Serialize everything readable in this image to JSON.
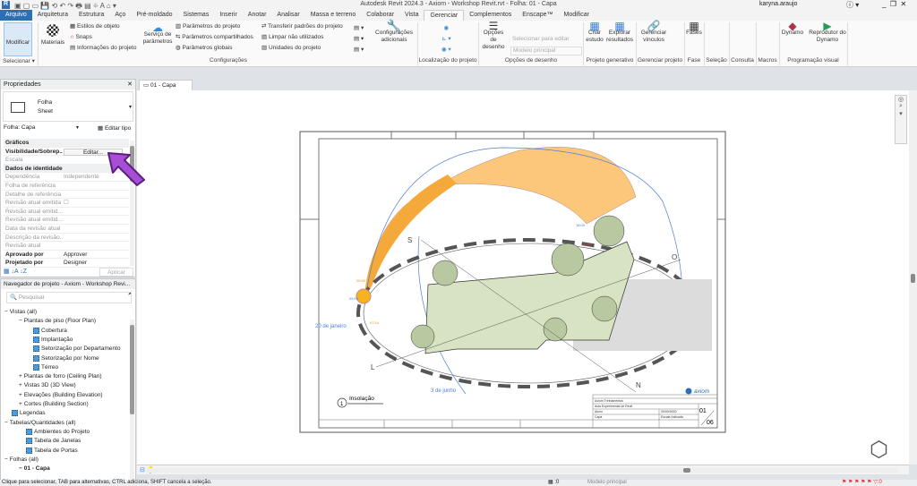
{
  "app": {
    "title": "Autodesk Revit 2024.3 - Axiom - Workshop Revit.rvt - Folha: 01 - Capa",
    "user": "karyna.araujo",
    "logo": "R"
  },
  "tabs": [
    "Arquivo",
    "Arquitetura",
    "Estrutura",
    "Aço",
    "Pré-moldado",
    "Sistemas",
    "Inserir",
    "Anotar",
    "Analisar",
    "Massa e terreno",
    "Colaborar",
    "Vista",
    "Gerenciar",
    "Complementos",
    "Enscape™",
    "Modificar"
  ],
  "active_tab": "Gerenciar",
  "ribbon": {
    "modificar": "Modificar",
    "materiais": "Materiais",
    "estilos": "Estilos de objeto",
    "snaps": "Snaps",
    "info": "Informações do projeto",
    "servico": "Serviço de parâmetros",
    "par_proj": "Parâmetros do projeto",
    "par_comp": "Parâmetros compartilhados",
    "par_glob": "Parâmetros globais",
    "transferir": "Transferir padrões do projeto",
    "limpar": "Limpar não utilizados",
    "unidades": "Unidades do projeto",
    "config_ad": "Configurações adicionais",
    "opcoes_des": "Opções de desenho",
    "sel_editar": "Selecionar para editar",
    "modelo_principal": "Modelo principal",
    "criar": "Criar estudo",
    "explorar": "Explorar resultados",
    "gerenciar_vinc": "Gerenciar vínculos",
    "fases": "Fases",
    "dynamo": "Dynamo",
    "reprodutor": "Reprodutor do Dynamo",
    "panels": [
      "Selecionar ▾",
      "Configurações",
      "Localização do projeto",
      "Opções de desenho",
      "Projeto generativo",
      "Gerenciar projeto",
      "Fase",
      "Seleção",
      "Consulta",
      "Macros",
      "Programação visual"
    ]
  },
  "properties": {
    "header": "Propriedades",
    "type_line1": "Folha",
    "type_line2": "Sheet",
    "instance": "Folha: Capa",
    "edit_type": "Editar tipo",
    "apply": "Aplicar",
    "rows": [
      {
        "k": "Gráficos",
        "v": "",
        "section": true
      },
      {
        "k": "Visibilidade/Sobrep...",
        "v": "Editar...",
        "bold": true
      },
      {
        "k": "Escala",
        "v": "",
        "grey": true
      },
      {
        "k": "Dados de identidade",
        "v": "",
        "section": true
      },
      {
        "k": "Dependência",
        "v": "Independente",
        "grey": true
      },
      {
        "k": "Folha de referência",
        "v": "",
        "grey": true
      },
      {
        "k": "Detalhe de referência",
        "v": "",
        "grey": true
      },
      {
        "k": "Revisão atual emitida",
        "v": "☐",
        "grey": true
      },
      {
        "k": "Revisão atual emitid...",
        "v": "",
        "grey": true
      },
      {
        "k": "Revisão atual emitid...",
        "v": "",
        "grey": true
      },
      {
        "k": "Data da revisão atual",
        "v": "",
        "grey": true
      },
      {
        "k": "Descrição da revisão...",
        "v": "",
        "grey": true
      },
      {
        "k": "Revisão atual",
        "v": "",
        "grey": true
      },
      {
        "k": "Aprovado por",
        "v": "Approver",
        "bold": true
      },
      {
        "k": "Projetado por",
        "v": "Designer",
        "bold": true
      }
    ]
  },
  "browser": {
    "header": "Navegador de projeto - Axiom - Workshop Revi...",
    "search_placeholder": "Pesquisar",
    "items": [
      {
        "t": "Vistas (all)",
        "lvl": 0,
        "exp": "−"
      },
      {
        "t": "Plantas de piso (Floor Plan)",
        "lvl": 1,
        "exp": "−"
      },
      {
        "t": "Cobertura",
        "lvl": 2,
        "icon": true
      },
      {
        "t": "Implantação",
        "lvl": 2,
        "icon": true
      },
      {
        "t": "Setorização por Departamento",
        "lvl": 2,
        "icon": true
      },
      {
        "t": "Setorização por Nome",
        "lvl": 2,
        "icon": true
      },
      {
        "t": "Térreo",
        "lvl": 2,
        "icon": true
      },
      {
        "t": "Plantas de forro (Ceiling Plan)",
        "lvl": 1,
        "exp": "+"
      },
      {
        "t": "Vistas 3D (3D View)",
        "lvl": 1,
        "exp": "+"
      },
      {
        "t": "Elevações (Building Elevation)",
        "lvl": 1,
        "exp": "+"
      },
      {
        "t": "Cortes (Building Section)",
        "lvl": 1,
        "exp": "+"
      },
      {
        "t": "Legendas",
        "lvl": 0.5,
        "icon": true
      },
      {
        "t": "Tabelas/Quantidades (all)",
        "lvl": 0,
        "exp": "−"
      },
      {
        "t": "Ambientes do Projeto",
        "lvl": 1.5,
        "icon": true
      },
      {
        "t": "Tabela de Janelas",
        "lvl": 1.5,
        "icon": true
      },
      {
        "t": "Tabela de Portas",
        "lvl": 1.5,
        "icon": true
      },
      {
        "t": "Folhas (all)",
        "lvl": 0,
        "exp": "−"
      },
      {
        "t": "01 - Capa",
        "lvl": 1,
        "exp": "−",
        "bold": true
      }
    ]
  },
  "view": {
    "tab": "01 - Capa",
    "view_title": "Insolação",
    "view_number": "1",
    "labels": {
      "s": "S",
      "o": "O",
      "l": "L",
      "n": "N",
      "jan": "20 de janeiro",
      "jun": "3 de junho",
      "t1": "18:00",
      "t2": "07:14",
      "t3": "09:00",
      "t4": "06:00",
      "t5": "16:38"
    },
    "titleblock": {
      "brand": "axiom",
      "r1": "Axiom Treinamentos",
      "r2": "Aula Experimental de Revit",
      "r3": "Aluno",
      "r3v": "00/00/0000",
      "r4": "Capa",
      "r4v": "Escala Indicada",
      "sheet": "01",
      "total": "06"
    }
  },
  "viewbar": {
    "model": "Modelo principal",
    "count": ":0"
  },
  "status": "Clique para selecionar, TAB para alternativas, CTRL adiciona, SHIFT cancela a seleção.",
  "colors": {
    "accent": "#2d6fb5",
    "sun": "#f7a93a",
    "site": "#d7e3c3",
    "arrow": "#a64fd6"
  }
}
